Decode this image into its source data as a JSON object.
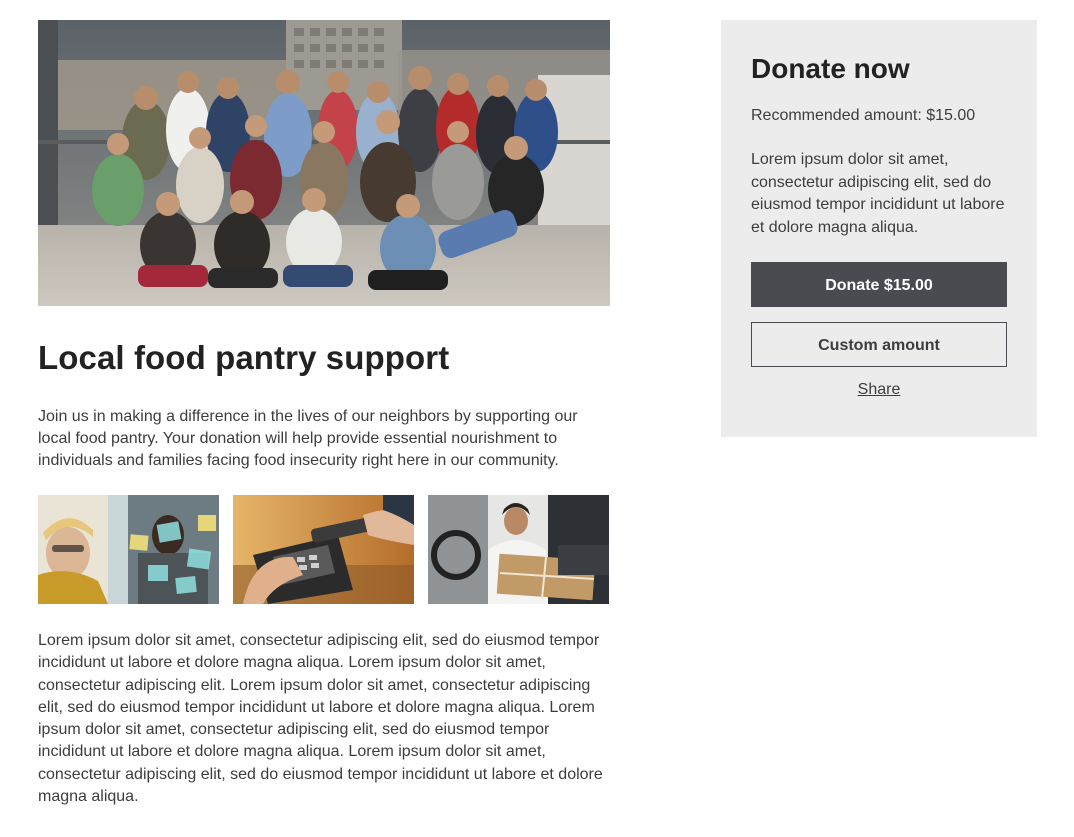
{
  "campaign": {
    "title": "Local food pantry support",
    "intro": "Join us in making a difference in the lives of our neighbors by supporting our local food pantry. Your donation will help provide essential nourishment to individuals and families facing food insecurity right here in our community.",
    "body": "Lorem ipsum dolor sit amet, consectetur adipiscing elit, sed do eiusmod tempor incididunt ut labore et dolore magna aliqua. Lorem ipsum dolor sit amet, consectetur adipiscing elit. Lorem ipsum dolor sit amet, consectetur adipiscing elit, sed do eiusmod tempor incididunt ut labore et dolore magna aliqua. Lorem ipsum dolor sit amet, consectetur adipiscing elit, sed do eiusmod tempor incididunt ut labore et dolore magna aliqua. Lorem ipsum dolor sit amet, consectetur adipiscing elit, sed do eiusmod tempor incididunt ut labore et dolore magna aliqua."
  },
  "donate": {
    "title": "Donate now",
    "recommended": "Recommended amount: $15.00",
    "description": "Lorem ipsum dolor sit amet, consectetur adipiscing elit, sed do eiusmod tempor incididunt ut labore et dolore magna aliqua.",
    "donate_button": "Donate $15.00",
    "custom_button": "Custom amount",
    "share_link": "Share"
  },
  "colors": {
    "card_background": "#ececec",
    "primary_button": "#4a4b50",
    "text": "#3d3d3d",
    "heading": "#222222"
  }
}
